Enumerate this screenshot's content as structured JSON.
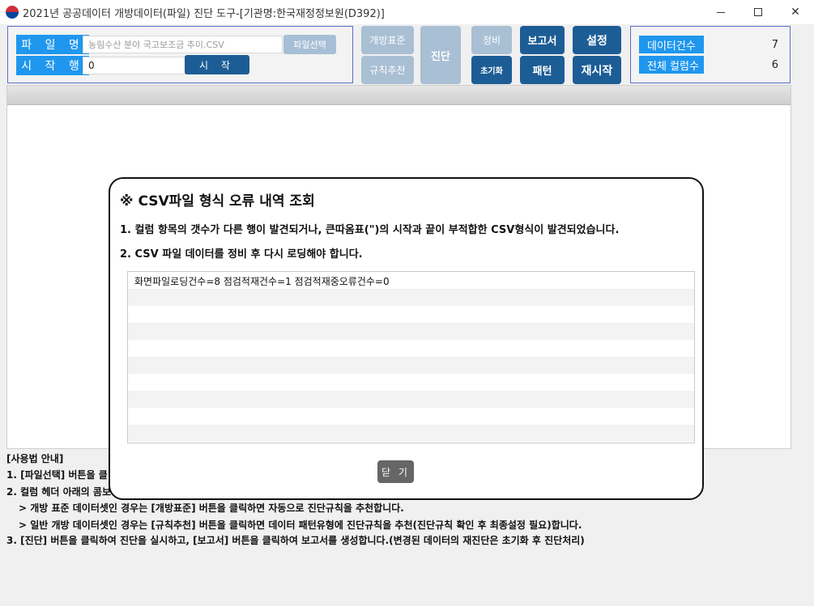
{
  "window": {
    "title": "2021년 공공데이터 개방데이터(파일) 진단 도구-[기관명:한국재정정보원(D392)]",
    "minimize": "",
    "maximize": "",
    "close": "✕"
  },
  "file_panel": {
    "file_label": "파 일 명",
    "file_value": "농림수산 분야 국고보조금 추이.CSV",
    "file_select_button": "파일선택",
    "start_row_label": "시 작 행",
    "start_row_value": "0",
    "start_button": "시 작"
  },
  "toolbar": {
    "open_standard": "개방표준",
    "rule_recommend": "규칙추천",
    "diagnose": "진단",
    "cleanup": "정비",
    "reset": "초기화",
    "report": "보고서",
    "pattern": "패턴",
    "settings": "설정",
    "restart": "재시작"
  },
  "stats": {
    "data_count_label": "데이터건수",
    "data_count_value": "7",
    "column_count_label": "전체 컬럼수",
    "column_count_value": "6"
  },
  "guide": {
    "heading": "[사용법 안내]",
    "line1": "1.  [파일선택] 버튼을 클",
    "line2": "2.  컬럼 헤더 아래의 콤보",
    "line2a": "> 개방 표준 데이터셋인 경우는 [개방표준] 버튼을 클릭하면 자동으로 진단규칙을 추천합니다.",
    "line2b": "> 일반 개방 데이터셋인 경우는 [규칙추천] 버튼을 클릭하면 데이터 패턴유형에 진단규칙을 추천(진단규칙 확인 후 최종설정 필요)합니다.",
    "line3": "3.  [진단] 버튼을 클릭하여 진단을 실시하고, [보고서] 버튼을 클릭하여 보고서를 생성합니다.(변경된 데이터의 재진단은 초기화 후 진단처리)"
  },
  "modal": {
    "title": "※ CSV파일 형식 오류 내역 조회",
    "line1": "1. 컬럼 항목의 갯수가 다른 행이 발견되거나, 큰따옴표(\")의 시작과 끝이 부적합한 CSV형식이 발견되었습니다.",
    "line2": "2. CSV 파일 데이터를 정비 후 다시 로딩해야 합니다.",
    "list_rows": [
      "화면파일로딩건수=8 점검적재건수=1 점검적재중오류건수=0"
    ],
    "close_button": "닫 기"
  },
  "colors": {
    "label_blue": "#1f97ee",
    "button_dark": "#1d5d95",
    "button_disabled": "#a9bfd4",
    "panel_border": "#5b6fc8"
  }
}
